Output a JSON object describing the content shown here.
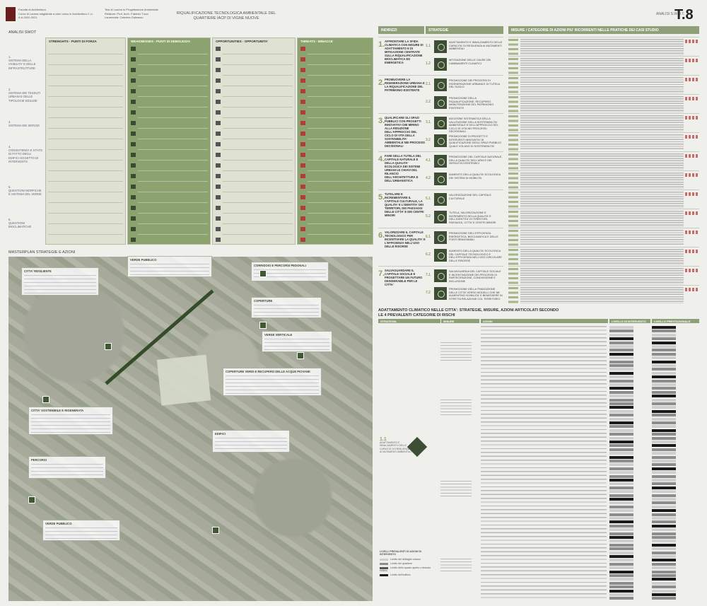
{
  "header": {
    "faculty": [
      "Facoltà di Architettura",
      "Corso di Laurea magistrale a ciclo unico in Architettura C.U.",
      "A.A.2020-2021"
    ],
    "thesis": [
      "Tesi di Laurea in Progettazione Ambientale",
      "Relatore: Prof. Arch. Fabrizio Tucci",
      "Laureanda: Caterina Galeasso"
    ],
    "title": "RIQUALIFICAZIONE TECNOLOGICA AMBIENTALE DEL QUARTIERE IACP DI VIGNE NUOVE",
    "sheet_label": "ANALISI S.W.O.T.",
    "sheet_number": "T.8"
  },
  "swot": {
    "section_title": "ANALISI SWOT",
    "categories": [
      {
        "num": "1.",
        "label": "SISTEMA DELLA VIABILITA' E DELLE INFRASTRUTTURE"
      },
      {
        "num": "2.",
        "label": "SISTEMA DEI TESSUTI URBANI E DELLE TIPOLOGIE EDILIZIE"
      },
      {
        "num": "3.",
        "label": "SISTEMA DEI SERVIZI"
      },
      {
        "num": "4.",
        "label": "CONSISTENZA E STATO DI FATTO DEGLI EDIFICI OGGETTO DI INTERVENTO"
      },
      {
        "num": "5.",
        "label": "QUESTIONI MORFICHE E SISTEMA DEL VERDE"
      },
      {
        "num": "6.",
        "label": "QUESTIONI BIOCLIMATICHE"
      }
    ],
    "columns": [
      {
        "label": "STRENGHTS - PUNTI DI FORZA"
      },
      {
        "label": "WEAKNESSES - PUNTI DI DEBOLEZZA"
      },
      {
        "label": "OPPORTUNITIES - OPPORTUNITA'"
      },
      {
        "label": "THREATS - MINACCE"
      }
    ]
  },
  "masterplan": {
    "section_title": "MASTERPLAN STRATEGIE E AZIONI",
    "boxes": [
      {
        "title": "CITTA' RESILIENTE"
      },
      {
        "title": "VERDE PUBBLICO"
      },
      {
        "title": "CORRIDOIO E PERCORSI PEDONALI"
      },
      {
        "title": "COPERTURE"
      },
      {
        "title": "VERDE VERTICALE"
      },
      {
        "title": "COPERTURE VERDI E RECUPERO DELLE ACQUE PIOVANE"
      },
      {
        "title": "CITTA' SOSTENIBILE E RIGENERATA"
      },
      {
        "title": "EDIFICI"
      },
      {
        "title": "PERCORSI"
      },
      {
        "title": "VERDE PUBBLICO"
      }
    ]
  },
  "indirizzi": {
    "header_indirizzi": "INDIRIZZI",
    "header_strategie": "STRATEGIE",
    "rows": [
      {
        "num": "1.",
        "label": "AFFRONTARE LA SFIDA CLIMATICA CON MISURE DI ADATTAMENTO E DI MITIGAZIONE CENTRATE SULLA RIQUALIFICAZIONE BIOCLIMATICA ED ENERGETICA",
        "strategies": [
          {
            "code": "1.1",
            "label": "ADATTAMENTO E INNALZAMENTO DELLE CAPACITA' DI RESILIENZA AI MUTAMENTI AMBIENTALI"
          },
          {
            "code": "1.2",
            "label": "MITIGAZIONE DELLE CAUSE DEI CAMBIAMENTI CLIMATICI"
          }
        ]
      },
      {
        "num": "2.",
        "label": "PROMUOVERE LA RIGENERAZIONE URBANA E LA RIQUALIFICAZIONE DEL PATRIMONIO ESISTENTE",
        "strategies": [
          {
            "code": "2.1",
            "label": "PROMOZIONE DEI PROCESSI DI RIGENERAZIONE URBANA E DI TUTELA DEL SUOLO"
          },
          {
            "code": "2.2",
            "label": "PROMOZIONE DELLA RIQUALIFICAZIONE, RECUPERO, MANUTENZIONE DEL PATRIMONIO ESISTENTE"
          }
        ]
      },
      {
        "num": "3.",
        "label": "QUALIFICARE GLI SPAZI PUBBLICI CON PROGETTI INNOVATIVI CHE MIRINO ALLA RIDUZIONE DELL'APPROCCIO DEL CICLO DI VITA DELLA SOSTENIBILITA' AMBIENTALE NEI PROCESSI DECISIONALI",
        "strategies": [
          {
            "code": "3.1",
            "label": "ADOZIONE SISTEMATICA DELLA VALUTAZIONE DELLA SOSTENIBILITA' AMBIENTALE E DELL'APPROCCIO DEL CICLO DI VITA NEI PROCESSI DECISIONALI"
          },
          {
            "code": "3.2",
            "label": "PROMOZIONE DI PROGETTI E INTERVENTI INNOVATIVI DI QUALIFICAZIONE DEGLI SPAZI PUBBLICI QUALE VOLANO DI SOSTENIBILITA'"
          }
        ]
      },
      {
        "num": "4.",
        "label": "FARE DELLA TUTELA DEL CAPITALE NATURALE E DELLA QUALITA' ECOLOGICA DEI SISTEMI URBANI LE CHIAVI DEL RILANCIO DELL'ARCHITETTURA E DELL'URBANISTICA",
        "strategies": [
          {
            "code": "4.1",
            "label": "PROMOZIONE DEL CAPITALE NATURALE, DELLA QUALITA' DELL'ARIA E DEI SERVIZI ECOSISTEMICI"
          },
          {
            "code": "4.2",
            "label": "AUMENTO DELLA QUALITA' ECOLOGICA DEI SISTEMI DI MOBILITA'"
          }
        ]
      },
      {
        "num": "5.",
        "label": "TUTELARE E INCREMENTARE IL CAPITALE CULTURALE, LA QUALITA' E L'IDENTITA' DEI TERRITORI, DEI PAESAGGI DELLE CITTA' E DEI CENTRI MINORI",
        "strategies": [
          {
            "code": "5.1",
            "label": "VALORIZZAZIONE DEL CAPITALE CULTURALE"
          },
          {
            "code": "5.2",
            "label": "TUTELA, VALORIZZAZIONE E INCREMENTO DELLA QUALITA' E DELL'IDENTITA' DI TERRITORI, PAESAGGI, CITTA' E CENTRI MINORI"
          }
        ]
      },
      {
        "num": "6.",
        "label": "VALORIZZARE IL CAPITALE TECNOLOGICO PER INCENTIVARE LA QUALITA' E L'EFFICIENZA NELL'USO DELLE RISORSE",
        "strategies": [
          {
            "code": "6.1",
            "label": "PROMOZIONE DELL'EFFICIENZA ENERGETICA, BIOCLIMATICA E DELLE FONTI RINNOVABILI"
          },
          {
            "code": "6.2",
            "label": "AUMENTO DELLA QUALITA' ECOLOGICA DEL CAPITALE TECNOLOGICO E DELL'EFFICIENZA NELL'USO CIRCOLARE DELLE RISORSE"
          }
        ]
      },
      {
        "num": "7.",
        "label": "SALVAGUARDARE IL CAPITALE SOCIALE E PROGETTARE UN FUTURO DESIDERABILE PER LE CITTA'",
        "strategies": [
          {
            "code": "7.1",
            "label": "SALVAGUARDIA DEL CAPITALE SOCIALE E INCENTIVAZIONE DEI PROCESSI DI PARTECIPAZIONE, CONDIVISIONE E INCLUSIONE"
          },
          {
            "code": "7.2",
            "label": "PROMOZIONE DELLA TRANSIZIONE DELLE CITTA' VERSO MODELLI CHE NE AUMENTINO VIVIBILITA' E BENESSERE IN STRETTA RELAZIONE COL TERRITORIO"
          }
        ]
      }
    ]
  },
  "misure": {
    "header": "MISURE / CATEGORIE DI AZIONI PIU' RICORRENTI NELLE PRATICHE DEI CASI STUDIO"
  },
  "adattamento": {
    "title": "ADATTAMENTO CLIMATICO NELLE CITTA': STRATEGIE, MISURE, AZIONI ARTICOLATI SECONDO LE 4 PREVALENTI CATEGORIE DI RISCHI",
    "headers": {
      "strategia": "STRATEGIA",
      "misure": "MISURE",
      "azioni": "AZIONI",
      "livello1": "LIVELLO DI INTERVENTO",
      "livello2": "LIVELLO PRESTAZIONALE"
    },
    "strategy_code": "1.1",
    "strategy_label": "ADATTAMENTO E INNALZAMENTO DELLE CAPACITA' DI RESILIENZA AI MUTAMENTI AMBIENTALI",
    "legend_title": "LIVELLI PREVALENTI DI AZIONI DI INTERVENTO",
    "legend": [
      {
        "label": "Livello del dettaglio urbano",
        "color": "#cfcfcf"
      },
      {
        "label": "Livello del quartiere",
        "color": "#8d8d8d"
      },
      {
        "label": "Livello dello spazio aperto o tessuto edilizio",
        "color": "#555555"
      },
      {
        "label": "Livello dell'edificio",
        "color": "#1a1a1a"
      }
    ]
  }
}
